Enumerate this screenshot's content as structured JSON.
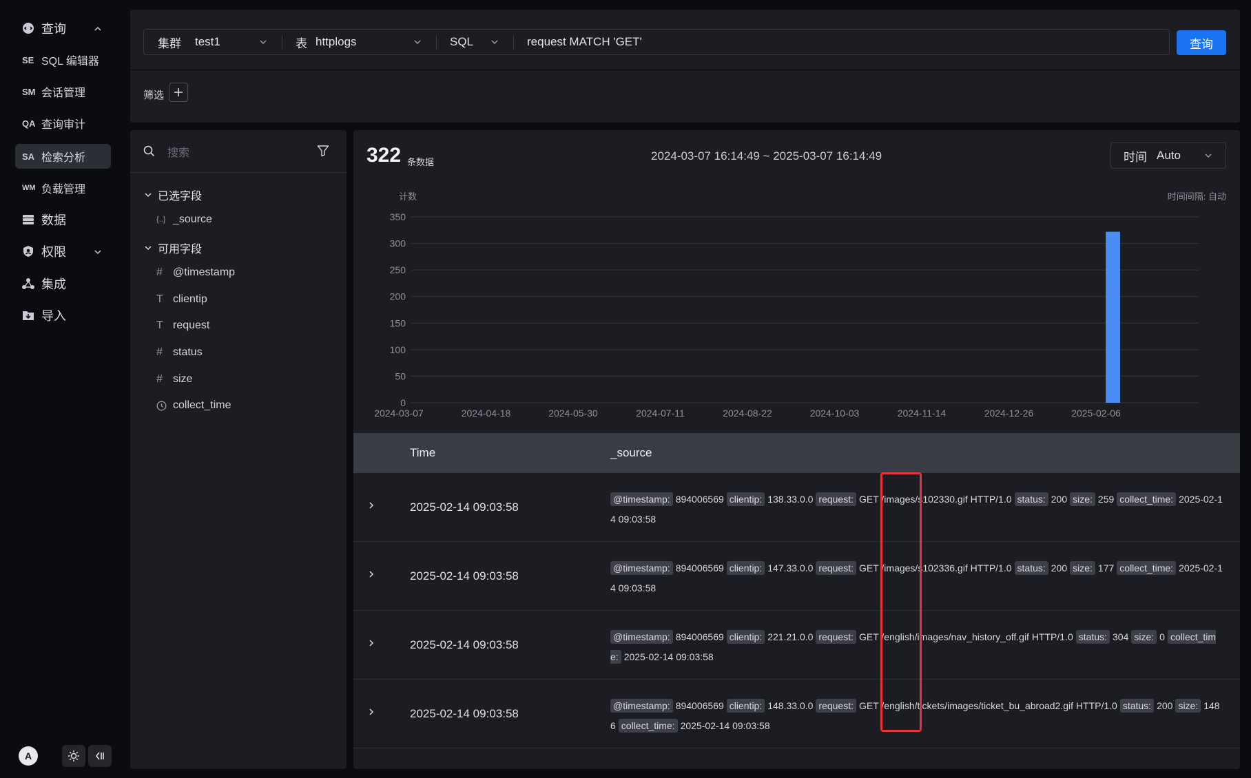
{
  "sidebar": {
    "top": {
      "label": "查询"
    },
    "items": [
      {
        "abbr": "SE",
        "label": "SQL 编辑器"
      },
      {
        "abbr": "SM",
        "label": "会话管理"
      },
      {
        "abbr": "QA",
        "label": "查询审计"
      },
      {
        "abbr": "SA",
        "label": "检索分析"
      },
      {
        "abbr": "WM",
        "label": "负载管理"
      }
    ],
    "data": {
      "label": "数据"
    },
    "perm": {
      "label": "权限"
    },
    "integration": {
      "label": "集成"
    },
    "import": {
      "label": "导入"
    },
    "avatar": "A"
  },
  "query_bar": {
    "cluster_label": "集群",
    "cluster_value": "test1",
    "table_label": "表",
    "table_value": "httplogs",
    "mode": "SQL",
    "query": "request MATCH 'GET'",
    "submit": "查询",
    "filter_label": "筛选"
  },
  "fields": {
    "search_placeholder": "搜索",
    "selected_title": "已选字段",
    "selected": [
      {
        "type": "{..}",
        "name": "_source"
      }
    ],
    "available_title": "可用字段",
    "available": [
      {
        "type": "#",
        "name": "@timestamp"
      },
      {
        "type": "T",
        "name": "clientip"
      },
      {
        "type": "T",
        "name": "request"
      },
      {
        "type": "#",
        "name": "status"
      },
      {
        "type": "#",
        "name": "size"
      },
      {
        "type": "clock",
        "name": "collect_time"
      }
    ]
  },
  "results": {
    "count": "322",
    "count_unit": "条数据",
    "range": "2024-03-07 16:14:49 ~ 2025-03-07 16:14:49",
    "time_label": "时间",
    "time_value": "Auto",
    "col_time": "Time",
    "col_source": "_source",
    "rows": [
      {
        "time": "2025-02-14 09:03:58",
        "fields": [
          {
            "k": "@timestamp:",
            "v": "894006569"
          },
          {
            "k": "clientip:",
            "v": "138.33.0.0"
          },
          {
            "k": "request:",
            "v": "GET /images/s102330.gif HTTP/1.0"
          },
          {
            "k": "status:",
            "v": "200"
          },
          {
            "k": "size:",
            "v": "259"
          },
          {
            "k": "collect_time:",
            "v": "2025-02-14 09:03:58"
          }
        ]
      },
      {
        "time": "2025-02-14 09:03:58",
        "fields": [
          {
            "k": "@timestamp:",
            "v": "894006569"
          },
          {
            "k": "clientip:",
            "v": "147.33.0.0"
          },
          {
            "k": "request:",
            "v": "GET /images/s102336.gif HTTP/1.0"
          },
          {
            "k": "status:",
            "v": "200"
          },
          {
            "k": "size:",
            "v": "177"
          },
          {
            "k": "collect_time:",
            "v": "2025-02-14 09:03:58"
          }
        ]
      },
      {
        "time": "2025-02-14 09:03:58",
        "fields": [
          {
            "k": "@timestamp:",
            "v": "894006569"
          },
          {
            "k": "clientip:",
            "v": "221.21.0.0"
          },
          {
            "k": "request:",
            "v": "GET /english/images/nav_history_off.gif HTTP/1.0"
          },
          {
            "k": "status:",
            "v": "304"
          },
          {
            "k": "size:",
            "v": "0"
          },
          {
            "k": "collect_time:",
            "v": "2025-02-14 09:03:58"
          }
        ]
      },
      {
        "time": "2025-02-14 09:03:58",
        "fields": [
          {
            "k": "@timestamp:",
            "v": "894006569"
          },
          {
            "k": "clientip:",
            "v": "148.33.0.0"
          },
          {
            "k": "request:",
            "v": "GET /english/tickets/images/ticket_bu_abroad2.gif HTTP/1.0"
          },
          {
            "k": "status:",
            "v": "200"
          },
          {
            "k": "size:",
            "v": "1486"
          },
          {
            "k": "collect_time:",
            "v": "2025-02-14 09:03:58"
          }
        ]
      }
    ]
  },
  "chart_data": {
    "type": "bar",
    "ylabel": "计数",
    "interval_label": "时间间隔: 自动",
    "ylim": [
      0,
      350
    ],
    "yticks": [
      "0",
      "50",
      "100",
      "150",
      "200",
      "250",
      "300",
      "350"
    ],
    "x_ticks": [
      "2024-03-07",
      "2024-04-18",
      "2024-05-30",
      "2024-07-11",
      "2024-08-22",
      "2024-10-03",
      "2024-11-14",
      "2024-12-26",
      "2025-02-06"
    ],
    "bars": [
      {
        "x": "2025-02-14",
        "value": 322
      }
    ],
    "bar_color": "#4a8ef5",
    "grid": true
  },
  "colors": {
    "accent": "#1a74f2",
    "highlight": "#e5343a"
  }
}
